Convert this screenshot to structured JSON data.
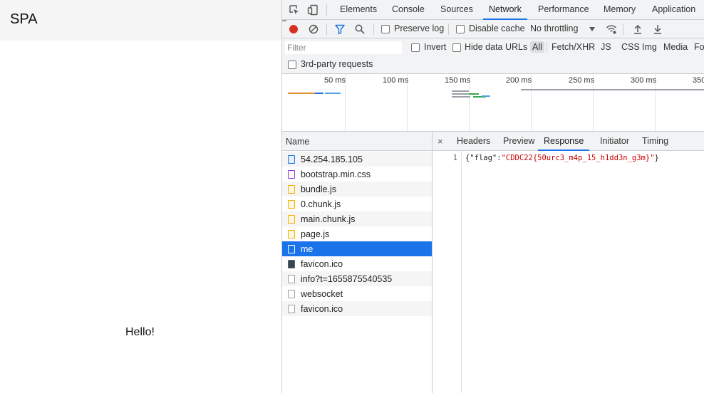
{
  "app": {
    "title": "SPA",
    "message": "Hello!"
  },
  "devtools": {
    "main_tabs": [
      {
        "label": "Elements"
      },
      {
        "label": "Console"
      },
      {
        "label": "Sources"
      },
      {
        "label": "Network",
        "active": true
      },
      {
        "label": "Performance"
      },
      {
        "label": "Memory"
      },
      {
        "label": "Application"
      }
    ],
    "toolbar": {
      "preserve_log": "Preserve log",
      "disable_cache": "Disable cache",
      "throttling": "No throttling"
    },
    "filter": {
      "placeholder": "Filter",
      "invert": "Invert",
      "hide_data_urls": "Hide data URLs",
      "types": [
        "All",
        "Fetch/XHR",
        "JS",
        "CSS",
        "Img",
        "Media",
        "Fo"
      ],
      "third_party": "3rd-party requests"
    },
    "overview": {
      "ticks": [
        "50 ms",
        "100 ms",
        "150 ms",
        "200 ms",
        "250 ms",
        "300 ms",
        "350"
      ]
    },
    "requests": {
      "header": "Name",
      "items": [
        {
          "name": "54.254.185.105",
          "type": "document"
        },
        {
          "name": "bootstrap.min.css",
          "type": "stylesheet"
        },
        {
          "name": "bundle.js",
          "type": "script"
        },
        {
          "name": "0.chunk.js",
          "type": "script"
        },
        {
          "name": "main.chunk.js",
          "type": "script"
        },
        {
          "name": "page.js",
          "type": "script"
        },
        {
          "name": "me",
          "type": "fetch",
          "selected": true
        },
        {
          "name": "favicon.ico",
          "type": "image"
        },
        {
          "name": "info?t=1655875540535",
          "type": "fetch"
        },
        {
          "name": "websocket",
          "type": "websocket"
        },
        {
          "name": "favicon.ico",
          "type": "other"
        }
      ]
    },
    "detail": {
      "close": "×",
      "tabs": [
        {
          "label": "Headers"
        },
        {
          "label": "Preview"
        },
        {
          "label": "Response",
          "active": true
        },
        {
          "label": "Initiator"
        },
        {
          "label": "Timing"
        }
      ],
      "response": {
        "line_number": "1",
        "key": "\"flag\"",
        "value": "\"CDDC22{50urc3_m4p_15_h1dd3n_g3m}\""
      }
    },
    "colors": {
      "accent": "#1a73e8",
      "record": "#d93025",
      "toolbar_bg": "#f1f3f4"
    }
  }
}
